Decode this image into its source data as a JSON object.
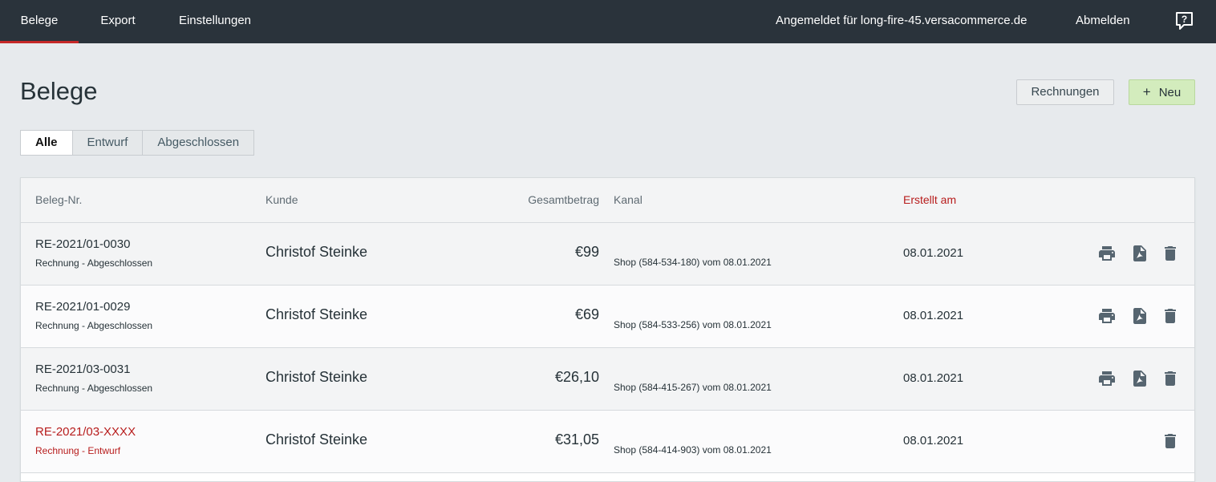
{
  "nav": {
    "tabs": [
      {
        "label": "Belege",
        "active": true
      },
      {
        "label": "Export",
        "active": false
      },
      {
        "label": "Einstellungen",
        "active": false
      }
    ],
    "logged_in_text": "Angemeldet für long-fire-45.versacommerce.de",
    "logout_label": "Abmelden",
    "help_icon": "help-question-icon"
  },
  "page": {
    "title": "Belege",
    "rechnungen_button": "Rechnungen",
    "new_button": "Neu",
    "new_button_icon": "+"
  },
  "filters": [
    {
      "label": "Alle",
      "active": true
    },
    {
      "label": "Entwurf",
      "active": false
    },
    {
      "label": "Abgeschlossen",
      "active": false
    }
  ],
  "table": {
    "headers": {
      "beleg_nr": "Beleg-Nr.",
      "kunde": "Kunde",
      "gesamtbetrag": "Gesamtbetrag",
      "kanal": "Kanal",
      "erstellt_am": "Erstellt am"
    },
    "sorted_column": "erstellt_am",
    "sorted_color": "#b71c1c",
    "rows": [
      {
        "nr": "RE-2021/01-0030",
        "status": "Rechnung - Abgeschlossen",
        "kunde": "Christof Steinke",
        "betrag": "€99",
        "kanal": "Shop (584-534-180) vom 08.01.2021",
        "datum": "08.01.2021",
        "draft": false
      },
      {
        "nr": "RE-2021/01-0029",
        "status": "Rechnung - Abgeschlossen",
        "kunde": "Christof Steinke",
        "betrag": "€69",
        "kanal": "Shop (584-533-256) vom 08.01.2021",
        "datum": "08.01.2021",
        "draft": false
      },
      {
        "nr": "RE-2021/03-0031",
        "status": "Rechnung - Abgeschlossen",
        "kunde": "Christof Steinke",
        "betrag": "€26,10",
        "kanal": "Shop (584-415-267) vom 08.01.2021",
        "datum": "08.01.2021",
        "draft": false
      },
      {
        "nr": "RE-2021/03-XXXX",
        "status": "Rechnung - Entwurf",
        "kunde": "Christof Steinke",
        "betrag": "€31,05",
        "kanal": "Shop (584-414-903) vom 08.01.2021",
        "datum": "08.01.2021",
        "draft": true
      }
    ]
  },
  "colors": {
    "nav_bg": "#2a333b",
    "accent": "#c62828",
    "new_button_bg": "#d3ecbd"
  }
}
